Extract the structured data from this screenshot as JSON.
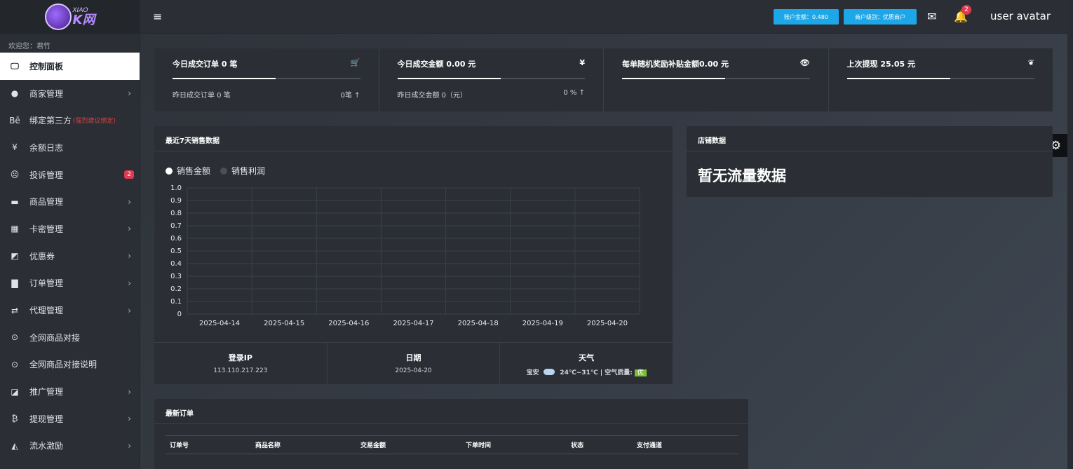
{
  "sidebar": {
    "logo": {
      "small": "XIAO",
      "big": "K网"
    },
    "welcome": "欢迎您：君竹",
    "items": [
      {
        "label": "控制面板",
        "icon": "monitor-icon",
        "glyph": "🖵",
        "active": true,
        "chevron": false
      },
      {
        "label": "商家管理",
        "icon": "user-circle-icon",
        "glyph": "●",
        "chevron": true
      },
      {
        "label": "绑定第三方",
        "note": "(强烈建议绑定)",
        "icon": "behance-icon",
        "glyph": "Bē",
        "chevron": false
      },
      {
        "label": "余额日志",
        "icon": "yen-icon",
        "glyph": "¥",
        "chevron": false
      },
      {
        "label": "投诉管理",
        "icon": "frown-icon",
        "glyph": "☹",
        "badge": "2",
        "chevron": false
      },
      {
        "label": "商品管理",
        "icon": "shopping-bag-icon",
        "glyph": "▬",
        "chevron": true
      },
      {
        "label": "卡密管理",
        "icon": "grid-icon",
        "glyph": "▦",
        "chevron": true
      },
      {
        "label": "优惠券",
        "icon": "coupon-icon",
        "glyph": "◩",
        "chevron": true
      },
      {
        "label": "订单管理",
        "icon": "bar-chart-icon",
        "glyph": "▇",
        "chevron": true
      },
      {
        "label": "代理管理",
        "icon": "exchange-icon",
        "glyph": "⇄",
        "chevron": true
      },
      {
        "label": "全网商品对接",
        "icon": "dot-circle-icon",
        "glyph": "⊙",
        "chevron": false
      },
      {
        "label": "全网商品对接说明",
        "icon": "dot-circle-icon",
        "glyph": "⊙",
        "chevron": false
      },
      {
        "label": "推广管理",
        "icon": "external-link-icon",
        "glyph": "◪",
        "chevron": true
      },
      {
        "label": "提现管理",
        "icon": "bitcoin-icon",
        "glyph": "₿",
        "chevron": true
      },
      {
        "label": "流水激励",
        "icon": "gitlab-icon",
        "glyph": "◭",
        "chevron": true
      }
    ]
  },
  "header": {
    "account_balance": "账户金额：0.480",
    "merchant_level": "商户级别：优质商户",
    "bell_badge": "2",
    "avatar": "user avatar"
  },
  "stats": [
    {
      "title": "今日成交订单 0 笔",
      "icon": "cart-icon",
      "glyph": "🛒",
      "progress": 0.55,
      "sub_left": "昨日成交订单 0 笔",
      "sub_right": "0笔 ↑"
    },
    {
      "title": "今日成交金额 0.00 元",
      "icon": "yen-icon",
      "glyph": "¥",
      "progress": 0.55,
      "sub_left": "昨日成交金额 0（元）",
      "sub_right": "0 % ↑"
    },
    {
      "title": "每单随机奖励补贴金额0.00 元",
      "icon": "eye-icon",
      "glyph": "👁",
      "progress": 0.55,
      "sub_left": "",
      "sub_right": ""
    },
    {
      "title": "上次提现 25.05 元",
      "icon": "leaf-icon",
      "glyph": "❦",
      "progress": 0.55,
      "sub_left": "",
      "sub_right": ""
    }
  ],
  "sales_panel": {
    "title": "最近7天销售数据",
    "info": [
      {
        "label": "登录IP",
        "value": "113.110.217.223"
      },
      {
        "label": "日期",
        "value": "2025-04-20"
      },
      {
        "label": "天气",
        "city": "宝安",
        "temp": "24℃~31℃ | 空气质量:",
        "aq": "优"
      }
    ]
  },
  "chart_data": {
    "type": "line",
    "categories": [
      "2025-04-14",
      "2025-04-15",
      "2025-04-16",
      "2025-04-17",
      "2025-04-18",
      "2025-04-19",
      "2025-04-20"
    ],
    "series": [
      {
        "name": "销售金额",
        "values": [
          0,
          0,
          0,
          0,
          0,
          0,
          0
        ],
        "color": "#ffffff"
      },
      {
        "name": "销售利润",
        "values": [
          0,
          0,
          0,
          0,
          0,
          0,
          0
        ],
        "color": "#4a4f57"
      }
    ],
    "ylim": [
      0,
      1.0
    ],
    "yticks": [
      "0",
      "0.1",
      "0.2",
      "0.3",
      "0.4",
      "0.5",
      "0.6",
      "0.7",
      "0.8",
      "0.9",
      "1.0"
    ],
    "grid": true,
    "legend": "top-left"
  },
  "store_panel": {
    "title": "店铺数据",
    "message": "暂无流量数据"
  },
  "orders_panel": {
    "title": "最新订单",
    "columns": [
      "订单号",
      "商品名称",
      "交易金额",
      "下单时间",
      "状态",
      "支付通道"
    ]
  }
}
